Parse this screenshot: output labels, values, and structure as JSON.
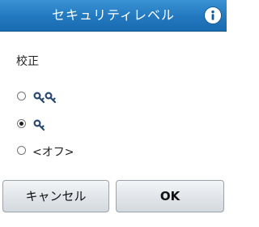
{
  "title": "セキュリティレベル",
  "info_icon": "info-icon",
  "section_label": "校正",
  "options": [
    {
      "icon": "double-key-icon",
      "selected": false
    },
    {
      "icon": "single-key-icon",
      "selected": true
    },
    {
      "label": "<オフ>",
      "selected": false
    }
  ],
  "buttons": {
    "cancel": "キャンセル",
    "ok": "OK"
  },
  "colors": {
    "title_bar": "#2278bf",
    "key_icon": "#2a4a6e"
  }
}
